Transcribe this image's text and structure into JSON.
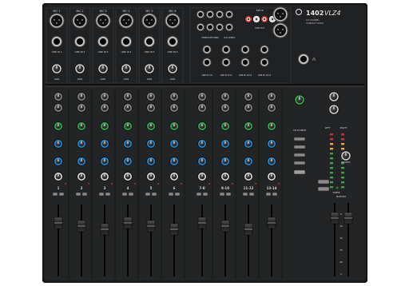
{
  "model": {
    "number": "1402",
    "suffix": "VLZ4"
  },
  "tagline": [
    "14-CHANNEL",
    "COMPACT MIXER"
  ],
  "brand_color": "#e8e8e8",
  "knob_colors": {
    "eq_high": "#2db84a",
    "eq_mid": "#1f8fe0",
    "eq_low": "#1f8fe0",
    "pan": "#dddddd"
  },
  "mic_labels": [
    "MIC 1",
    "MIC 2",
    "MIC 3",
    "MIC 4",
    "MIC 5",
    "MIC 6"
  ],
  "line_labels": [
    "LINE IN 1",
    "LINE IN 2",
    "LINE IN 3",
    "LINE IN 4",
    "LINE IN 5",
    "LINE IN 6"
  ],
  "gain_label": "GAIN",
  "stereo_rear_labels": [
    "STEREO RETURNS",
    "AUX SENDS",
    "TAPE IN",
    "TAPE OUT"
  ],
  "stereo_in_labels": [
    "LINE IN 7/8",
    "LINE IN 9/10",
    "LINE IN 11/12",
    "LINE IN 13/14"
  ],
  "channel_numbers": [
    "1",
    "2",
    "3",
    "4",
    "5",
    "6",
    "7-8",
    "9-10",
    "11-12",
    "13-14"
  ],
  "master_labels": {
    "source": "CR SOURCE",
    "left": "LEFT",
    "right": "RIGHT",
    "main_mix": "MAIN MIX",
    "phones": "PHONES",
    "power": "POWER"
  },
  "fader_scale": [
    "U",
    "10",
    "20",
    "30",
    "40",
    "∞"
  ]
}
